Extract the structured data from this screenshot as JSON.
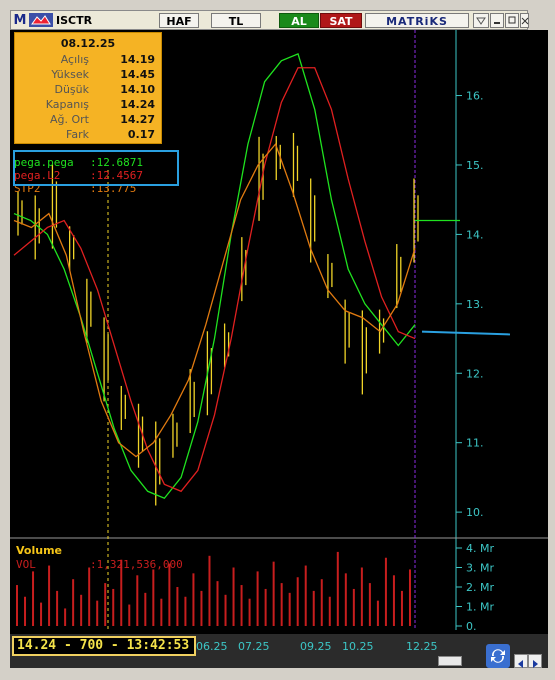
{
  "toolbar": {
    "logo": "M",
    "symbol": "ISCTR",
    "period": "HAF",
    "currency": "TL",
    "buy": "AL",
    "sell": "SAT",
    "brand": "MATRiKS"
  },
  "info": {
    "date": "08.12.25",
    "rows": [
      {
        "label": "Açılış",
        "value": "14.19"
      },
      {
        "label": "Yüksek",
        "value": "14.45"
      },
      {
        "label": "Düşük",
        "value": "14.10"
      },
      {
        "label": "Kapanış",
        "value": "14.24"
      },
      {
        "label": "Ağ. Ort",
        "value": "14.27"
      },
      {
        "label": "Fark",
        "value": "0.17"
      }
    ]
  },
  "legend": [
    {
      "name": "pega.pega",
      "value": ":12.6871",
      "color": "#1fe21f"
    },
    {
      "name": "pega.L2",
      "value": ":12.4567",
      "color": "#e02020"
    },
    {
      "name": "STP2",
      "value": ":13.775",
      "color": "#e07a10"
    }
  ],
  "volume": {
    "title": "Volume",
    "name": "VOL",
    "value": ":1,321,536,000"
  },
  "status": "14.24 - 700 - 13:42:53",
  "x_labels": [
    "06.25",
    "07.25",
    "09.25",
    "10.25",
    "12.25"
  ],
  "colors": {
    "price": "#f0d428",
    "green": "#1fe21f",
    "red": "#e02020",
    "orange": "#e07a10",
    "axis": "#3cc6c6",
    "volume": "#c81e1e",
    "highlight": "#2aa0e0"
  },
  "chart_data": {
    "type": "line",
    "y_ticks": [
      "10.",
      "11.",
      "12.",
      "13.",
      "14.",
      "15.",
      "16."
    ],
    "volume_ticks": [
      "4. Mr",
      "3. Mr",
      "2. Mr",
      "1. Mr",
      "0."
    ],
    "ylim": [
      9.8,
      16.8
    ],
    "series": [
      {
        "name": "pega.pega",
        "values": [
          14.3,
          14.2,
          14.0,
          13.5,
          12.8,
          12.0,
          11.2,
          10.6,
          10.3,
          10.2,
          10.5,
          11.3,
          12.5,
          14.0,
          15.3,
          16.2,
          16.5,
          16.6,
          15.8,
          14.5,
          13.5,
          13.0,
          12.7,
          12.4,
          12.7
        ]
      },
      {
        "name": "pega.L2",
        "values": [
          13.7,
          13.9,
          14.1,
          14.2,
          13.8,
          13.2,
          12.4,
          11.6,
          10.9,
          10.4,
          10.3,
          10.6,
          11.4,
          12.5,
          13.8,
          15.0,
          15.9,
          16.4,
          16.4,
          15.8,
          14.8,
          13.9,
          13.1,
          12.6,
          12.5
        ]
      },
      {
        "name": "STP2",
        "values": [
          14.2,
          14.1,
          14.3,
          13.7,
          12.6,
          11.6,
          11.0,
          10.8,
          11.0,
          11.4,
          11.9,
          12.7,
          13.6,
          14.5,
          15.0,
          15.3,
          14.6,
          13.8,
          13.2,
          12.9,
          12.8,
          12.6,
          13.0,
          13.8
        ]
      },
      {
        "name": "price_close",
        "values": [
          14.3,
          14.1,
          14.4,
          13.8,
          12.9,
          12.2,
          11.5,
          11.1,
          10.7,
          11.1,
          11.6,
          12.0,
          12.4,
          13.5,
          14.8,
          15.1,
          15.0,
          14.2,
          13.4,
          12.6,
          12.3,
          12.6,
          13.4,
          14.2
        ]
      }
    ],
    "volume_values": [
      2.1,
      1.5,
      2.8,
      1.2,
      3.1,
      1.8,
      0.9,
      2.4,
      1.6,
      3.0,
      1.3,
      2.2,
      1.9,
      3.4,
      1.1,
      2.6,
      1.7,
      2.9,
      1.4,
      3.2,
      2.0,
      1.5,
      2.7,
      1.8,
      3.6,
      2.3,
      1.6,
      3.0,
      2.1,
      1.4,
      2.8,
      1.9,
      3.3,
      2.2,
      1.7,
      2.5,
      3.1,
      1.8,
      2.4,
      1.5,
      3.8,
      2.7,
      1.9,
      3.0,
      2.2,
      1.3,
      3.5,
      2.6,
      1.8,
      2.9
    ]
  }
}
